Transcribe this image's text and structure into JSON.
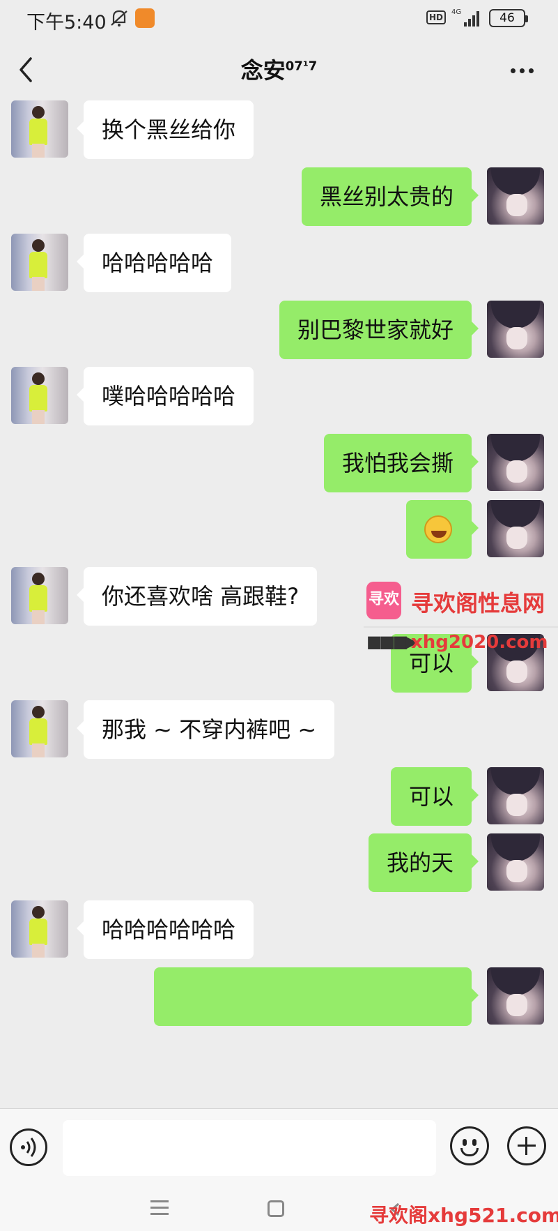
{
  "status_bar": {
    "time": "下午5:40",
    "network_badge": "HD",
    "network_type": "4G",
    "battery": "46"
  },
  "header": {
    "title": "念安",
    "title_sup": "07¹7"
  },
  "messages": [
    {
      "side": "left",
      "text": "换个黑丝给你"
    },
    {
      "side": "right",
      "text": "黑丝别太贵的"
    },
    {
      "side": "left",
      "text": "哈哈哈哈哈"
    },
    {
      "side": "right",
      "text": "别巴黎世家就好"
    },
    {
      "side": "left",
      "text": "噗哈哈哈哈哈"
    },
    {
      "side": "right",
      "text": "我怕我会撕"
    },
    {
      "side": "right",
      "text": "",
      "emoji": "laughing-tears-emoji"
    },
    {
      "side": "left",
      "text": "你还喜欢啥 高跟鞋?"
    },
    {
      "side": "right",
      "text": "可以"
    },
    {
      "side": "left",
      "text": "那我 ~ 不穿内裤吧 ~"
    },
    {
      "side": "right",
      "text": "可以"
    },
    {
      "side": "right",
      "text": "我的天"
    },
    {
      "side": "left",
      "text": "哈哈哈哈哈哈"
    },
    {
      "side": "right",
      "text": ""
    }
  ],
  "watermark": {
    "logo_text": "寻欢",
    "title": "寻欢阁性息网",
    "url": "xhg2020.com",
    "arrows": "■■■▶",
    "bottom": "寻欢阁xhg521.com"
  },
  "input_bar": {
    "placeholder": ""
  },
  "colors": {
    "background": "#ededed",
    "sent_bubble": "#95ec69",
    "received_bubble": "#ffffff",
    "watermark_red": "#e53b3b"
  },
  "icons": [
    "back-arrow-icon",
    "more-dots-icon",
    "voice-icon",
    "emoji-icon",
    "plus-icon",
    "menu-icon",
    "home-icon",
    "back-icon"
  ]
}
